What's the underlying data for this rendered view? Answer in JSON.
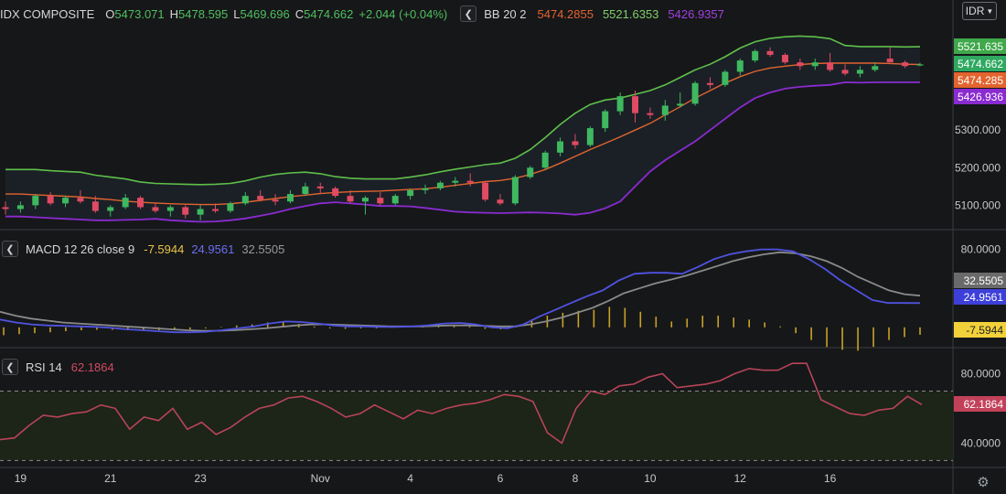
{
  "header": {
    "symbol": "IDX COMPOSITE",
    "o_label": "O",
    "o": "5473.071",
    "h_label": "H",
    "h": "5478.595",
    "l_label": "L",
    "l": "5469.696",
    "c_label": "C",
    "c": "5474.662",
    "change": "+2.044 (+0.04%)",
    "bb_label": "BB 20 2",
    "bb_mid": "5474.2855",
    "bb_upper": "5521.6353",
    "bb_lower": "5426.9357",
    "currency": "IDR"
  },
  "macd_header": {
    "label": "MACD 12 26 close 9",
    "hist": "-7.5944",
    "macd": "24.9561",
    "signal": "32.5505"
  },
  "rsi_header": {
    "label": "RSI 14",
    "value": "62.1864"
  },
  "colors": {
    "up": "#3fb85f",
    "down": "#e04a62",
    "bb_upper": "#5fbf4a",
    "bb_mid": "#e2642f",
    "bb_lower": "#8a2bd0",
    "macd": "#4f53e0",
    "signal": "#8a8a8a",
    "hist": "#c9a227",
    "rsi": "#b84458",
    "band_fill": "#1b2128",
    "rsi_fill": "#1d2418"
  },
  "chart_data": [
    {
      "type": "candlestick",
      "title": "IDX COMPOSITE",
      "x_tick_labels": [
        "19",
        "21",
        "23",
        "Nov",
        "4",
        "6",
        "8",
        "10",
        "12",
        "16"
      ],
      "x_tick_positions": [
        1,
        7,
        13,
        21,
        27,
        33,
        38,
        43,
        49,
        55
      ],
      "price_ticks": [
        "5300.000",
        "5200.000",
        "5100.000"
      ],
      "ylim": [
        5045,
        5585
      ],
      "ohlc": [
        [
          5095,
          5110,
          5075,
          5090
        ],
        [
          5090,
          5110,
          5080,
          5100
        ],
        [
          5100,
          5130,
          5090,
          5125
        ],
        [
          5125,
          5135,
          5100,
          5105
        ],
        [
          5105,
          5125,
          5095,
          5120
        ],
        [
          5120,
          5140,
          5105,
          5110
        ],
        [
          5110,
          5125,
          5080,
          5085
        ],
        [
          5085,
          5100,
          5070,
          5095
        ],
        [
          5095,
          5130,
          5090,
          5120
        ],
        [
          5120,
          5125,
          5090,
          5095
        ],
        [
          5095,
          5105,
          5080,
          5085
        ],
        [
          5085,
          5100,
          5070,
          5095
        ],
        [
          5095,
          5100,
          5065,
          5075
        ],
        [
          5075,
          5100,
          5060,
          5090
        ],
        [
          5090,
          5105,
          5080,
          5085
        ],
        [
          5085,
          5110,
          5080,
          5105
        ],
        [
          5105,
          5135,
          5100,
          5125
        ],
        [
          5125,
          5140,
          5110,
          5115
        ],
        [
          5115,
          5130,
          5100,
          5110
        ],
        [
          5110,
          5140,
          5105,
          5130
        ],
        [
          5130,
          5160,
          5125,
          5150
        ],
        [
          5150,
          5160,
          5130,
          5145
        ],
        [
          5145,
          5150,
          5120,
          5125
        ],
        [
          5125,
          5140,
          5105,
          5110
        ],
        [
          5110,
          5125,
          5075,
          5120
        ],
        [
          5120,
          5135,
          5100,
          5105
        ],
        [
          5105,
          5130,
          5100,
          5125
        ],
        [
          5125,
          5145,
          5115,
          5140
        ],
        [
          5140,
          5155,
          5130,
          5145
        ],
        [
          5145,
          5165,
          5140,
          5160
        ],
        [
          5160,
          5175,
          5150,
          5165
        ],
        [
          5165,
          5185,
          5150,
          5160
        ],
        [
          5160,
          5165,
          5110,
          5115
        ],
        [
          5115,
          5130,
          5100,
          5105
        ],
        [
          5105,
          5180,
          5100,
          5175
        ],
        [
          5175,
          5205,
          5170,
          5200
        ],
        [
          5200,
          5245,
          5195,
          5240
        ],
        [
          5240,
          5280,
          5230,
          5270
        ],
        [
          5270,
          5290,
          5250,
          5260
        ],
        [
          5260,
          5310,
          5255,
          5305
        ],
        [
          5305,
          5355,
          5295,
          5350
        ],
        [
          5350,
          5400,
          5340,
          5390
        ],
        [
          5390,
          5405,
          5320,
          5345
        ],
        [
          5345,
          5360,
          5330,
          5340
        ],
        [
          5340,
          5380,
          5325,
          5365
        ],
        [
          5365,
          5400,
          5360,
          5370
        ],
        [
          5370,
          5430,
          5365,
          5425
        ],
        [
          5425,
          5440,
          5410,
          5420
        ],
        [
          5420,
          5460,
          5415,
          5455
        ],
        [
          5455,
          5490,
          5445,
          5485
        ],
        [
          5485,
          5515,
          5480,
          5510
        ],
        [
          5510,
          5520,
          5495,
          5500
        ],
        [
          5500,
          5505,
          5475,
          5480
        ],
        [
          5480,
          5490,
          5460,
          5470
        ],
        [
          5470,
          5490,
          5460,
          5480
        ],
        [
          5480,
          5505,
          5455,
          5460
        ],
        [
          5460,
          5475,
          5445,
          5450
        ],
        [
          5450,
          5470,
          5440,
          5460
        ],
        [
          5460,
          5480,
          5455,
          5470
        ],
        [
          5490,
          5520,
          5480,
          5480
        ],
        [
          5480,
          5485,
          5465,
          5470
        ],
        [
          5473.071,
          5478.595,
          5469.696,
          5474.662
        ]
      ],
      "bb_upper": [
        5195,
        5195,
        5195,
        5192,
        5190,
        5188,
        5180,
        5175,
        5170,
        5162,
        5158,
        5157,
        5156,
        5155,
        5156,
        5158,
        5165,
        5175,
        5182,
        5186,
        5188,
        5184,
        5176,
        5172,
        5170,
        5170,
        5170,
        5175,
        5181,
        5189,
        5196,
        5202,
        5208,
        5212,
        5225,
        5248,
        5280,
        5315,
        5345,
        5368,
        5380,
        5385,
        5395,
        5405,
        5420,
        5440,
        5460,
        5475,
        5495,
        5518,
        5535,
        5544,
        5548,
        5550,
        5548,
        5543,
        5525,
        5522,
        5522,
        5522,
        5521,
        5521.635
      ],
      "bb_mid": [
        5130,
        5130,
        5128,
        5126,
        5124,
        5122,
        5118,
        5115,
        5111,
        5108,
        5106,
        5104,
        5103,
        5102,
        5102,
        5104,
        5108,
        5113,
        5118,
        5123,
        5127,
        5131,
        5134,
        5136,
        5137,
        5138,
        5140,
        5142,
        5144,
        5148,
        5153,
        5158,
        5163,
        5166,
        5172,
        5182,
        5195,
        5212,
        5230,
        5248,
        5265,
        5282,
        5300,
        5318,
        5340,
        5362,
        5385,
        5405,
        5425,
        5442,
        5456,
        5465,
        5470,
        5474,
        5477,
        5478,
        5478,
        5478,
        5478,
        5477,
        5475,
        5474.286
      ],
      "bb_lower": [
        5070,
        5070,
        5068,
        5066,
        5064,
        5062,
        5060,
        5060,
        5061,
        5062,
        5064,
        5060,
        5058,
        5056,
        5057,
        5060,
        5065,
        5072,
        5080,
        5090,
        5098,
        5105,
        5108,
        5105,
        5102,
        5098,
        5098,
        5097,
        5093,
        5088,
        5083,
        5081,
        5080,
        5079,
        5080,
        5081,
        5080,
        5078,
        5075,
        5080,
        5092,
        5110,
        5150,
        5190,
        5220,
        5245,
        5270,
        5300,
        5330,
        5360,
        5385,
        5400,
        5410,
        5415,
        5418,
        5420,
        5427,
        5426,
        5427,
        5427,
        5427,
        5426.936
      ]
    },
    {
      "type": "line",
      "title": "MACD 12 26 close 9",
      "y_ticks": [
        "80.0000"
      ],
      "ylim": [
        -18,
        90
      ],
      "series": [
        {
          "name": "MACD",
          "values": [
            8,
            5,
            3,
            2,
            1.5,
            1,
            0.5,
            -0.5,
            -2,
            -3,
            -4,
            -5,
            -5,
            -4.5,
            -3,
            -1,
            1,
            4,
            6,
            5.5,
            4,
            2,
            1,
            1,
            0.5,
            0.5,
            1,
            2,
            4,
            4.5,
            3,
            0,
            -1,
            3,
            11,
            18,
            25,
            32,
            38,
            48,
            55,
            56,
            56,
            55,
            62,
            70,
            75,
            78,
            80,
            80,
            78,
            70,
            60,
            48,
            38,
            28,
            25,
            25,
            24.9561
          ]
        },
        {
          "name": "Signal",
          "values": [
            16,
            12,
            9,
            7,
            5,
            4,
            3,
            2,
            1,
            0,
            -1,
            -2,
            -3,
            -3.5,
            -3.5,
            -3,
            -2,
            -1,
            0.5,
            2,
            3,
            3,
            2.5,
            2,
            1.5,
            1,
            1,
            1,
            1.5,
            2,
            2,
            1.5,
            1,
            1,
            3,
            6,
            10,
            15,
            20,
            27,
            35,
            40,
            45,
            49,
            53,
            58,
            63,
            68,
            72,
            75,
            77,
            76,
            73,
            68,
            61,
            52,
            45,
            38,
            34,
            32.5505
          ]
        },
        {
          "name": "Histogram",
          "values": [
            -8,
            -7,
            -6,
            -5,
            -4,
            -3,
            -2.5,
            -2.5,
            -3,
            -3,
            -3,
            -3,
            -2,
            -1,
            0.5,
            2,
            3,
            5,
            5.5,
            3.5,
            1,
            -1,
            -1.5,
            -1,
            -1,
            -0.5,
            0,
            1,
            2.5,
            2.5,
            1,
            -1.5,
            -2,
            2,
            8,
            12,
            15,
            17,
            18,
            21,
            20,
            16,
            11,
            6,
            9,
            12,
            12,
            10,
            8,
            5,
            1,
            -6,
            -13,
            -20,
            -23,
            -24,
            -20,
            -13,
            -10,
            -7.5944
          ]
        }
      ]
    },
    {
      "type": "line",
      "title": "RSI 14",
      "y_ticks": [
        "80.0000",
        "40.0000"
      ],
      "ylim": [
        27,
        94
      ],
      "bands": [
        70,
        30
      ],
      "series": [
        {
          "name": "RSI",
          "values": [
            42,
            43,
            50,
            56,
            55,
            57,
            58,
            62,
            60,
            48,
            55,
            53,
            60,
            48,
            52,
            45,
            49,
            55,
            60,
            62,
            66,
            67,
            64,
            60,
            55,
            57,
            62,
            58,
            54,
            59,
            57,
            60,
            62,
            63,
            65,
            68,
            67,
            64,
            46,
            40,
            60,
            70,
            68,
            73,
            74,
            78,
            80,
            72,
            73,
            74,
            76,
            80,
            83,
            82,
            82,
            86,
            86,
            65,
            61,
            57,
            56,
            59,
            60,
            67,
            62.1864
          ]
        }
      ]
    }
  ]
}
